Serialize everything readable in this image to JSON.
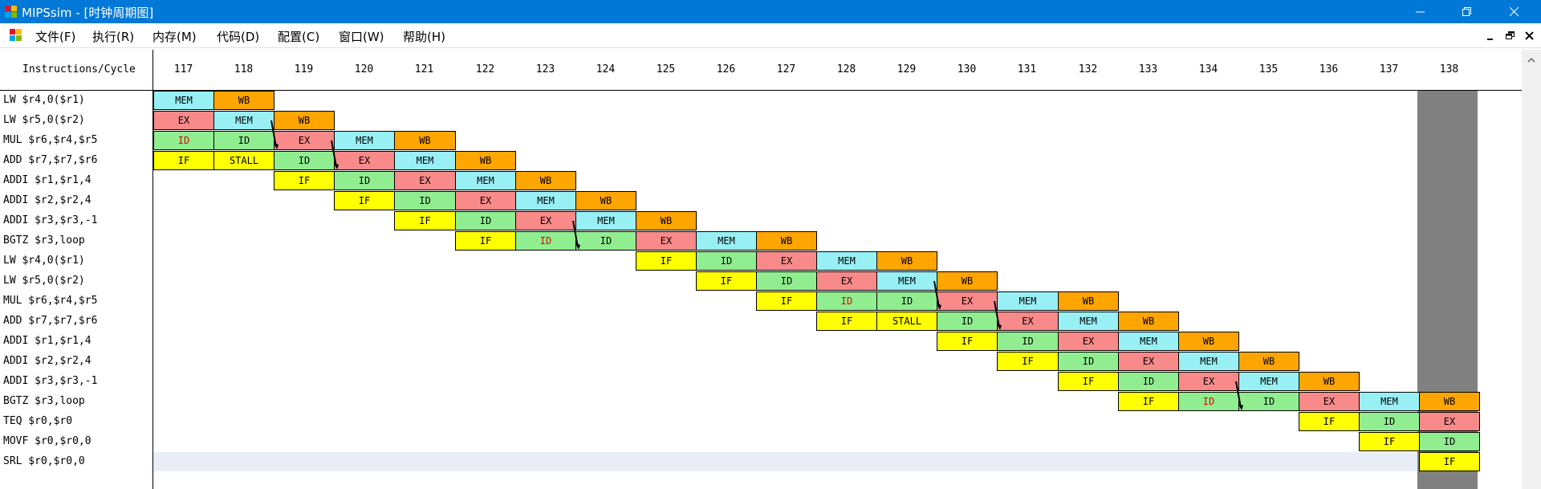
{
  "window": {
    "title": "MIPSsim - [时钟周期图]",
    "titlebar_color": "#0078d7",
    "controls": [
      "minimize-icon",
      "restore-icon",
      "close-icon"
    ]
  },
  "menu": {
    "items": [
      "文件(F)",
      "执行(R)",
      "内存(M)",
      "代码(D)",
      "配置(C)",
      "窗口(W)",
      "帮助(H)"
    ],
    "mdi_controls": [
      "minimize-icon",
      "restore-icon",
      "close-icon"
    ]
  },
  "diagram": {
    "header_label": "Instructions/Cycle",
    "cycles": [
      "117",
      "118",
      "119",
      "120",
      "121",
      "122",
      "123",
      "124",
      "125",
      "126",
      "127",
      "128",
      "129",
      "130",
      "131",
      "132",
      "133",
      "134",
      "135",
      "136",
      "137",
      "138"
    ],
    "stage_colors": {
      "IF": "#ffff00",
      "ID": "#90ee90",
      "EX": "#f88a8a",
      "MEM": "#98f0f5",
      "WB": "#ffa500",
      "STALL": "#ffff00"
    },
    "current_cycle": "138",
    "instructions": [
      {
        "label": "LW $r4,0($r1)",
        "start": 0,
        "stages": [
          "MEM",
          "WB"
        ]
      },
      {
        "label": "LW $r5,0($r2)",
        "start": 0,
        "stages": [
          "EX",
          "MEM",
          "WB"
        ]
      },
      {
        "label": "MUL $r6,$r4,$r5",
        "start": 0,
        "stages": [
          "ID",
          "ID",
          "EX",
          "MEM",
          "WB"
        ],
        "red": [
          0
        ]
      },
      {
        "label": "ADD $r7,$r7,$r6",
        "start": 0,
        "stages": [
          "IF",
          "STALL",
          "ID",
          "EX",
          "MEM",
          "WB"
        ]
      },
      {
        "label": "ADDI $r1,$r1,4",
        "start": 2,
        "stages": [
          "IF",
          "ID",
          "EX",
          "MEM",
          "WB"
        ]
      },
      {
        "label": "ADDI $r2,$r2,4",
        "start": 3,
        "stages": [
          "IF",
          "ID",
          "EX",
          "MEM",
          "WB"
        ]
      },
      {
        "label": "ADDI $r3,$r3,-1",
        "start": 4,
        "stages": [
          "IF",
          "ID",
          "EX",
          "MEM",
          "WB"
        ]
      },
      {
        "label": "BGTZ $r3,loop",
        "start": 5,
        "stages": [
          "IF",
          "ID",
          "ID",
          "EX",
          "MEM",
          "WB"
        ],
        "red": [
          1
        ]
      },
      {
        "label": "LW $r4,0($r1)",
        "start": 8,
        "stages": [
          "IF",
          "ID",
          "EX",
          "MEM",
          "WB"
        ]
      },
      {
        "label": "LW $r5,0($r2)",
        "start": 9,
        "stages": [
          "IF",
          "ID",
          "EX",
          "MEM",
          "WB"
        ]
      },
      {
        "label": "MUL $r6,$r4,$r5",
        "start": 10,
        "stages": [
          "IF",
          "ID",
          "ID",
          "EX",
          "MEM",
          "WB"
        ],
        "red": [
          1
        ]
      },
      {
        "label": "ADD $r7,$r7,$r6",
        "start": 11,
        "stages": [
          "IF",
          "STALL",
          "ID",
          "EX",
          "MEM",
          "WB"
        ]
      },
      {
        "label": "ADDI $r1,$r1,4",
        "start": 13,
        "stages": [
          "IF",
          "ID",
          "EX",
          "MEM",
          "WB"
        ]
      },
      {
        "label": "ADDI $r2,$r2,4",
        "start": 14,
        "stages": [
          "IF",
          "ID",
          "EX",
          "MEM",
          "WB"
        ]
      },
      {
        "label": "ADDI $r3,$r3,-1",
        "start": 15,
        "stages": [
          "IF",
          "ID",
          "EX",
          "MEM",
          "WB"
        ]
      },
      {
        "label": "BGTZ $r3,loop",
        "start": 16,
        "stages": [
          "IF",
          "ID",
          "ID",
          "EX",
          "MEM",
          "WB"
        ],
        "red": [
          1
        ]
      },
      {
        "label": "TEQ $r0,$r0",
        "start": 19,
        "stages": [
          "IF",
          "ID",
          "EX"
        ]
      },
      {
        "label": "MOVF $r0,$r0,0",
        "start": 20,
        "stages": [
          "IF",
          "ID"
        ]
      },
      {
        "label": "SRL $r0,$r0,0",
        "start": 21,
        "stages": [
          "IF"
        ]
      }
    ],
    "forwarding_arrows": [
      {
        "from_row": 1,
        "from_cycle": 1,
        "to_row": 2,
        "to_cycle": 2
      },
      {
        "from_row": 2,
        "from_cycle": 2,
        "to_row": 3,
        "to_cycle": 3
      },
      {
        "from_row": 6,
        "from_cycle": 6,
        "to_row": 7,
        "to_cycle": 7
      },
      {
        "from_row": 9,
        "from_cycle": 12,
        "to_row": 10,
        "to_cycle": 13
      },
      {
        "from_row": 10,
        "from_cycle": 13,
        "to_row": 11,
        "to_cycle": 14
      },
      {
        "from_row": 14,
        "from_cycle": 17,
        "to_row": 15,
        "to_cycle": 18
      }
    ]
  }
}
